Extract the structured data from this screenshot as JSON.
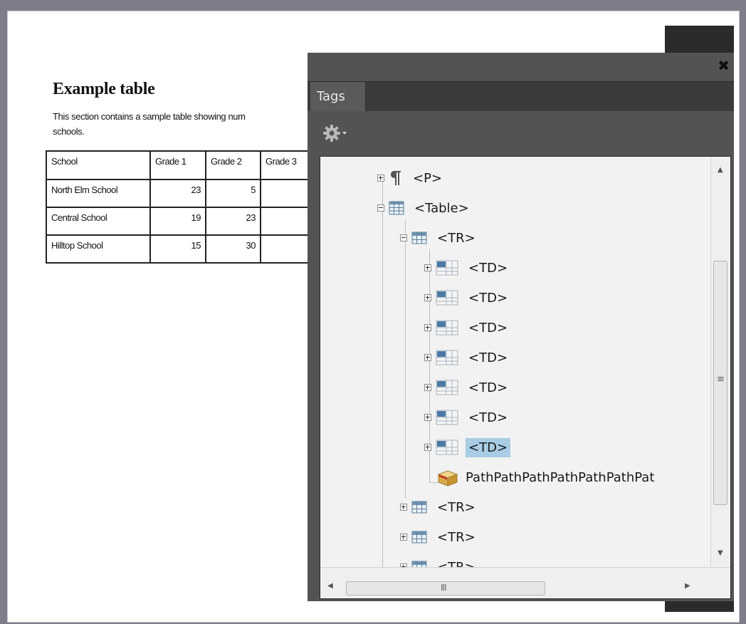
{
  "document": {
    "heading": "Example table",
    "paragraph_line1": "This section contains a sample table showing num",
    "paragraph_line2": "schools.",
    "table": {
      "headers": [
        "School",
        "Grade 1",
        "Grade 2",
        "Grade 3"
      ],
      "rows": [
        [
          "North Elm School",
          "23",
          "5",
          ""
        ],
        [
          "Central School",
          "19",
          "23",
          ""
        ],
        [
          "Hilltop School",
          "15",
          "30",
          ""
        ]
      ]
    }
  },
  "panel": {
    "tab_label": "Tags",
    "close_glyph": "✖",
    "options_icon": "gear-icon",
    "tree": [
      {
        "label": "<P>",
        "icon": "paragraph-icon",
        "expander": "plus"
      },
      {
        "label": "<Table>",
        "icon": "table-icon",
        "expander": "minus"
      },
      {
        "label": "<TR>",
        "icon": "table-row-icon",
        "expander": "minus"
      },
      {
        "label": "<TD>",
        "icon": "table-cell-icon",
        "expander": "plus"
      },
      {
        "label": "<TD>",
        "icon": "table-cell-icon",
        "expander": "plus"
      },
      {
        "label": "<TD>",
        "icon": "table-cell-icon",
        "expander": "plus"
      },
      {
        "label": "<TD>",
        "icon": "table-cell-icon",
        "expander": "plus"
      },
      {
        "label": "<TD>",
        "icon": "table-cell-icon",
        "expander": "plus"
      },
      {
        "label": "<TD>",
        "icon": "table-cell-icon",
        "expander": "plus"
      },
      {
        "label": "<TD>",
        "icon": "table-cell-icon",
        "expander": "plus",
        "selected": true
      },
      {
        "label": "PathPathPathPathPathPathPat",
        "icon": "artifact-box-icon",
        "expander": "none"
      },
      {
        "label": "<TR>",
        "icon": "table-row-icon",
        "expander": "plus"
      },
      {
        "label": "<TR>",
        "icon": "table-row-icon",
        "expander": "plus"
      },
      {
        "label": "<TR>",
        "icon": "table-row-icon",
        "expander": "plus"
      }
    ],
    "hscroll_grip": "III",
    "vscroll_grip": "≡"
  },
  "colors": {
    "panel_bg": "#535353",
    "tree_bg": "#f2f2f2",
    "selection": "#a8cde4",
    "window_frame": "#7f7c8a"
  }
}
